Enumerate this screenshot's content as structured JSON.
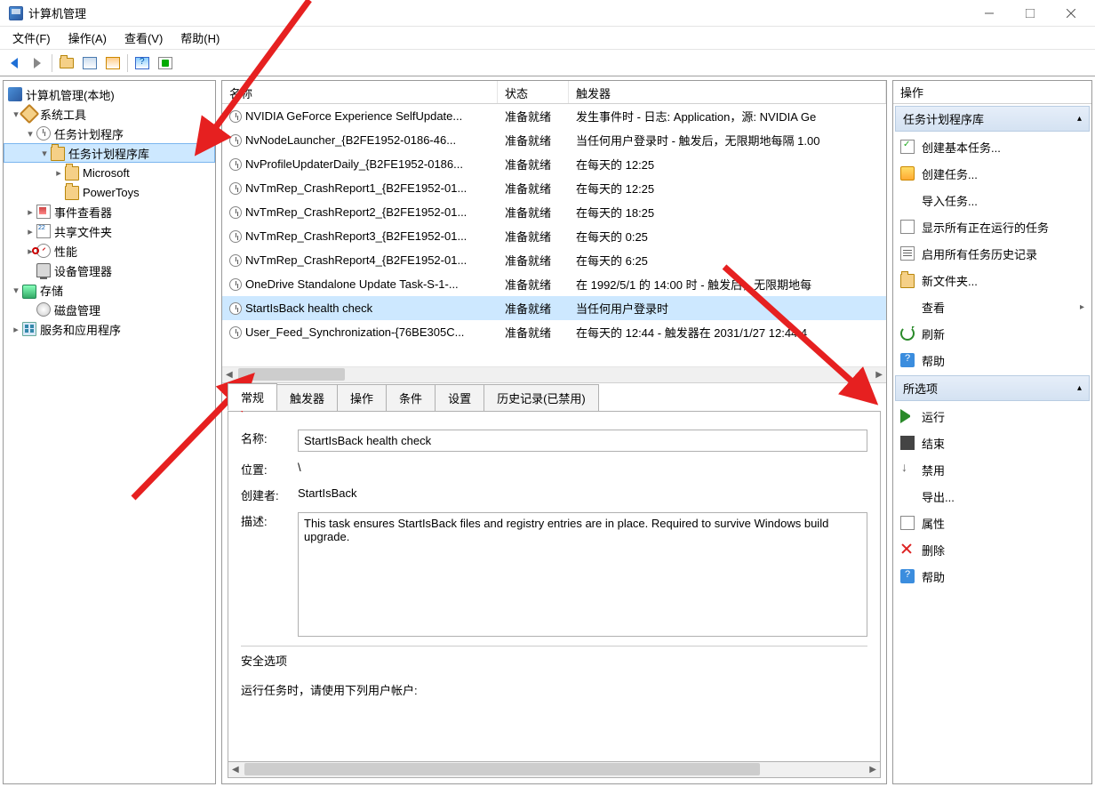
{
  "window": {
    "title": "计算机管理"
  },
  "menu": [
    "文件(F)",
    "操作(A)",
    "查看(V)",
    "帮助(H)"
  ],
  "tree": {
    "root": "计算机管理(本地)",
    "system_tools": "系统工具",
    "task_scheduler": "任务计划程序",
    "library": "任务计划程序库",
    "microsoft": "Microsoft",
    "powertoys": "PowerToys",
    "event_viewer": "事件查看器",
    "shared_folders": "共享文件夹",
    "performance": "性能",
    "device_manager": "设备管理器",
    "storage": "存储",
    "disk_management": "磁盘管理",
    "services_apps": "服务和应用程序"
  },
  "columns": {
    "name": "名称",
    "state": "状态",
    "trigger": "触发器"
  },
  "tasks": [
    {
      "name": "NVIDIA GeForce Experience SelfUpdate...",
      "state": "准备就绪",
      "trigger": "发生事件时 - 日志: Application，源: NVIDIA Ge"
    },
    {
      "name": "NvNodeLauncher_{B2FE1952-0186-46...",
      "state": "准备就绪",
      "trigger": "当任何用户登录时 - 触发后，无限期地每隔 1.00"
    },
    {
      "name": "NvProfileUpdaterDaily_{B2FE1952-0186...",
      "state": "准备就绪",
      "trigger": "在每天的 12:25"
    },
    {
      "name": "NvTmRep_CrashReport1_{B2FE1952-01...",
      "state": "准备就绪",
      "trigger": "在每天的 12:25"
    },
    {
      "name": "NvTmRep_CrashReport2_{B2FE1952-01...",
      "state": "准备就绪",
      "trigger": "在每天的 18:25"
    },
    {
      "name": "NvTmRep_CrashReport3_{B2FE1952-01...",
      "state": "准备就绪",
      "trigger": "在每天的 0:25"
    },
    {
      "name": "NvTmRep_CrashReport4_{B2FE1952-01...",
      "state": "准备就绪",
      "trigger": "在每天的 6:25"
    },
    {
      "name": "OneDrive Standalone Update Task-S-1-...",
      "state": "准备就绪",
      "trigger": "在 1992/5/1 的 14:00 时 - 触发后，无限期地每"
    },
    {
      "name": "StartIsBack health check",
      "state": "准备就绪",
      "trigger": "当任何用户登录时"
    },
    {
      "name": "User_Feed_Synchronization-{76BE305C...",
      "state": "准备就绪",
      "trigger": "在每天的 12:44 - 触发器在 2031/1/27 12:44:4"
    }
  ],
  "tabs": {
    "general": "常规",
    "triggers": "触发器",
    "actions": "操作",
    "conditions": "条件",
    "settings": "设置",
    "history": "历史记录(已禁用)"
  },
  "detail": {
    "name_label": "名称:",
    "name_value": "StartIsBack health check",
    "location_label": "位置:",
    "location_value": "\\",
    "creator_label": "创建者:",
    "creator_value": "StartIsBack",
    "desc_label": "描述:",
    "desc_value": "This task ensures StartIsBack files and registry entries are in place. Required to survive Windows build upgrade.",
    "security_header": "安全选项",
    "security_line1": "运行任务时，请使用下列用户帐户:"
  },
  "actions": {
    "header": "操作",
    "section_library": "任务计划程序库",
    "create_basic": "创建基本任务...",
    "create_task": "创建任务...",
    "import_task": "导入任务...",
    "show_running": "显示所有正在运行的任务",
    "enable_history": "启用所有任务历史记录",
    "new_folder": "新文件夹...",
    "view": "查看",
    "refresh": "刷新",
    "help": "帮助",
    "section_selected": "所选项",
    "run": "运行",
    "end": "结束",
    "disable": "禁用",
    "export": "导出...",
    "properties": "属性",
    "delete": "删除"
  }
}
